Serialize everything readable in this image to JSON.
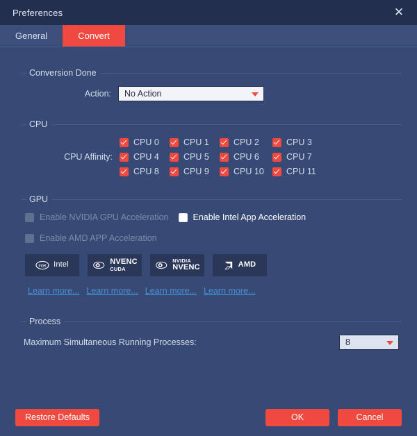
{
  "window": {
    "title": "Preferences",
    "close_icon": "close-icon"
  },
  "tabs": [
    {
      "label": "General",
      "active": false
    },
    {
      "label": "Convert",
      "active": true
    }
  ],
  "conversion_done": {
    "group_title": "Conversion Done",
    "action_label": "Action:",
    "action_value": "No Action"
  },
  "cpu": {
    "group_title": "CPU",
    "affinity_label": "CPU Affinity:",
    "items": [
      {
        "label": "CPU 0",
        "checked": true
      },
      {
        "label": "CPU 1",
        "checked": true
      },
      {
        "label": "CPU 2",
        "checked": true
      },
      {
        "label": "CPU 3",
        "checked": true
      },
      {
        "label": "CPU 4",
        "checked": true
      },
      {
        "label": "CPU 5",
        "checked": true
      },
      {
        "label": "CPU 6",
        "checked": true
      },
      {
        "label": "CPU 7",
        "checked": true
      },
      {
        "label": "CPU 8",
        "checked": true
      },
      {
        "label": "CPU 9",
        "checked": true
      },
      {
        "label": "CPU 10",
        "checked": true
      },
      {
        "label": "CPU 11",
        "checked": true
      }
    ]
  },
  "gpu": {
    "group_title": "GPU",
    "options": [
      {
        "label": "Enable NVIDIA GPU Acceleration",
        "checked": false,
        "disabled": true
      },
      {
        "label": "Enable Intel App Acceleration",
        "checked": false,
        "disabled": false
      },
      {
        "label": "Enable AMD APP Acceleration",
        "checked": false,
        "disabled": true
      }
    ],
    "badges": [
      {
        "name": "Intel",
        "sub": "",
        "logo": "intel-logo-icon"
      },
      {
        "name": "NVENC",
        "sub": "CUDA",
        "logo": "nvidia-eye-logo-icon"
      },
      {
        "name": "NVENC",
        "sub": "NVIDIA",
        "logo": "nvidia-eye-logo-icon"
      },
      {
        "name": "AMD",
        "sub": "",
        "logo": "amd-arrow-logo-icon"
      }
    ],
    "links": [
      "Learn more...",
      "Learn more...",
      "Learn more...",
      "Learn more..."
    ]
  },
  "process": {
    "group_title": "Process",
    "label": "Maximum Simultaneous Running Processes:",
    "value": "8"
  },
  "footer": {
    "restore": "Restore Defaults",
    "ok": "OK",
    "cancel": "Cancel"
  },
  "colors": {
    "accent_red": "#f0493f",
    "window_bg": "#374a75",
    "titlebar_bg": "#232f4f",
    "link_blue": "#4a8fd4",
    "badge_bg": "#2b3759"
  }
}
